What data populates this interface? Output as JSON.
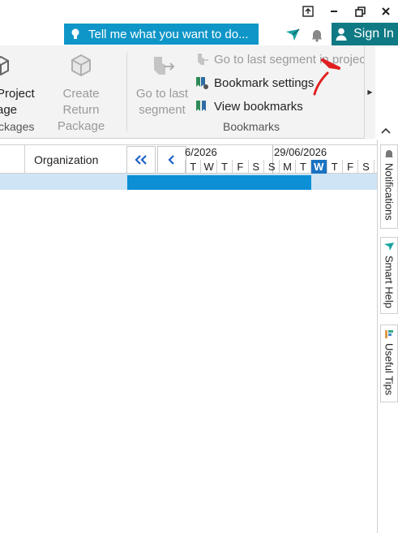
{
  "titlebar": {
    "tell_me": "Tell me what you want to do...",
    "sign_in": "Sign In"
  },
  "ribbon": {
    "project_package_line1": "Project",
    "project_package_line2": "age",
    "create_return_line1": "Create Return",
    "create_return_line2": "Package",
    "packages_group": "ckages",
    "go_last_line1": "Go to last",
    "go_last_line2": "segment",
    "go_last_in_project": "Go to last segment in project",
    "bookmark_settings": "Bookmark settings",
    "view_bookmarks": "View bookmarks",
    "bookmarks_group": "Bookmarks"
  },
  "grid": {
    "organization_header": "Organization",
    "date_1": "6/2026",
    "date_2": "29/06/2026",
    "days": [
      "T",
      "W",
      "T",
      "F",
      "S",
      "S",
      "M",
      "T",
      "W",
      "T",
      "F",
      "S",
      "S"
    ],
    "today_index": 8
  },
  "side": {
    "notifications": "Notifications",
    "smart_help": "Smart Help",
    "useful_tips": "Useful Tips"
  },
  "colors": {
    "accent": "#0f96c8",
    "sign_in_bg": "#0f7a84",
    "bar": "#0d8fd6",
    "selection": "#cfe4f5"
  }
}
